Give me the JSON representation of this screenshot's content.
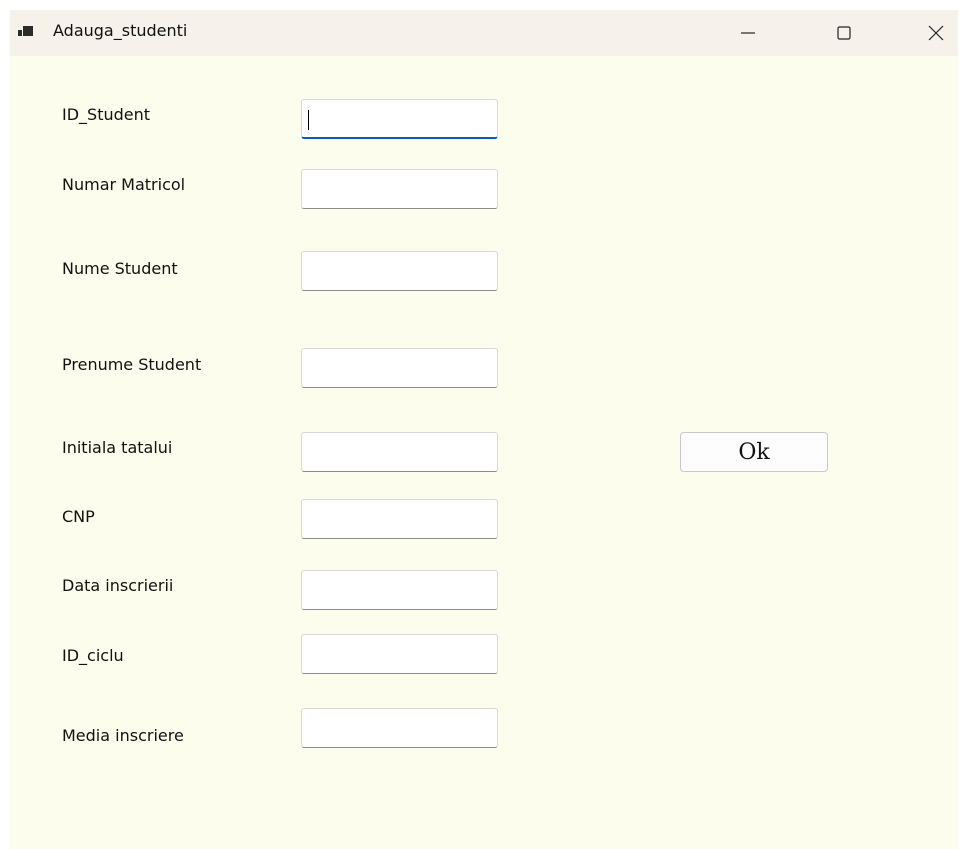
{
  "window": {
    "title": "Adauga_studenti",
    "icon": "app-window-icon",
    "controls": [
      "minimize-icon",
      "maximize-icon",
      "close-icon"
    ]
  },
  "form": {
    "fields": [
      {
        "label": "ID_Student",
        "value": "",
        "focused": true
      },
      {
        "label": "Numar Matricol",
        "value": ""
      },
      {
        "label": "Nume Student",
        "value": ""
      },
      {
        "label": "Prenume Student",
        "value": ""
      },
      {
        "label": "Initiala tatalui",
        "value": ""
      },
      {
        "label": "CNP",
        "value": ""
      },
      {
        "label": "Data inscrierii",
        "value": ""
      },
      {
        "label": "ID_ciclu",
        "value": ""
      },
      {
        "label": "Media inscriere",
        "value": ""
      }
    ],
    "ok_label": "Ok"
  },
  "colors": {
    "form_background": "#fdfdee",
    "titlebar": "#f7f1ec",
    "focus_accent": "#005fb8"
  }
}
